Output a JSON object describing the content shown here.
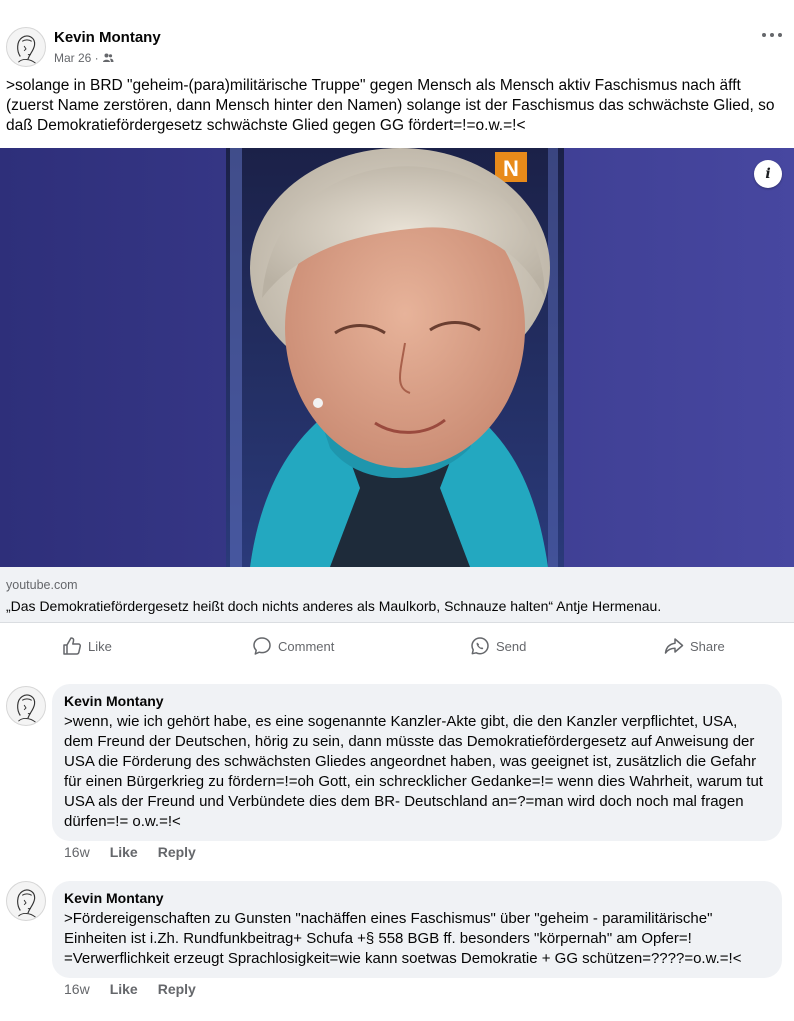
{
  "post": {
    "author": "Kevin Montany",
    "date": "Mar 26 ·",
    "privacy_icon": "friends-icon",
    "text": ">solange in BRD \"geheim-(para)militärische Truppe\" gegen Mensch als Mensch aktiv Faschismus nach äfft (zuerst Name zerstören, dann Mensch hinter den Namen) solange ist der Faschismus das schwächste Glied, so daß Demokratiefördergesetz schwächste Glied gegen GG fördert=!=o.w.=!<",
    "media": {
      "channel_badge": "N",
      "info_icon": "i"
    },
    "link": {
      "domain": "youtube.com",
      "title": "„Das Demokratiefördergesetz heißt doch nichts anderes als Maulkorb, Schnauze halten“ Antje Hermenau."
    }
  },
  "actions": {
    "like": "Like",
    "comment": "Comment",
    "send": "Send",
    "share": "Share"
  },
  "comments": [
    {
      "author": "Kevin Montany",
      "text": ">wenn, wie ich gehört habe, es eine sogenannte Kanzler-Akte gibt, die den Kanzler verpflichtet, USA, dem Freund der Deutschen,  hörig zu sein, dann müsste das Demokratiefördergesetz auf Anweisung der USA die Förderung des schwächsten Gliedes angeordnet haben, was geeignet ist, zusätzlich die Gefahr für einen Bürgerkrieg zu fördern=!=oh Gott, ein schrecklicher Gedanke=!= wenn dies Wahrheit, warum tut USA als der Freund und Verbündete dies dem BR- Deutschland an=?=man wird doch noch mal fragen dürfen=!= o.w.=!<",
      "time": "16w",
      "like": "Like",
      "reply": "Reply"
    },
    {
      "author": "Kevin Montany",
      "text": ">Fördereigenschaften zu Gunsten \"nachäffen eines Faschismus\" über \"geheim - paramilitärische\" Einheiten ist i.Zh. Rundfunkbeitrag+ Schufa +§ 558 BGB ff. besonders \"körpernah\" am Opfer=! =Verwerflichkeit erzeugt Sprachlosigkeit=wie kann soetwas Demokratie + GG schützen=????=o.w.=!<",
      "time": "16w",
      "like": "Like",
      "reply": "Reply"
    }
  ],
  "colors": {
    "secondary_text": "#65676b",
    "bubble_bg": "#f0f2f5",
    "media_bg": "#3a3a88"
  }
}
